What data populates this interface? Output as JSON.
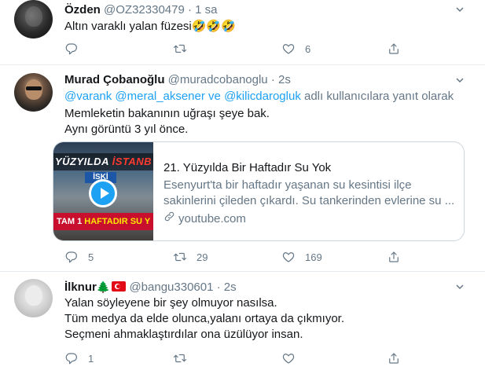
{
  "tweets": [
    {
      "name": "Özden",
      "handle": "@OZ32330479",
      "dot": "·",
      "time": "1 sa",
      "lines": [
        "Altın varaklı yalan füzesi🤣🤣🤣"
      ],
      "replies": "",
      "retweets": "",
      "likes": "6"
    },
    {
      "name": "Murad Çobanoğlu",
      "handle": "@muradcobanoglu",
      "dot": "·",
      "time": "2s",
      "reply_mentions": [
        "@varank",
        "@meral_aksener",
        "ve",
        "@kilicdarogluk"
      ],
      "reply_suffix": "adlı kullanıcılara yanıt olarak",
      "lines": [
        "Memleketin bakanının uğraşı şeye bak.",
        "Aynı görüntü 3 yıl önce."
      ],
      "card": {
        "thumb_top_white": "YÜZYILDA",
        "thumb_top_red": "İSTANB",
        "thumb_sign": "İSKİ",
        "thumb_bottom_white": "TAM 1",
        "thumb_bottom_yellow": "HAFTADIR SU Y",
        "title": "21. Yüzyılda Bir Haftadır Su Yok",
        "desc_line1": "Esenyurt'ta bir haftadır yaşanan su kesintisi ilçe",
        "desc_line2": "sakinlerini çileden çıkardı. Su tankerinden evlerine su ...",
        "link": "youtube.com"
      },
      "replies": "5",
      "retweets": "29",
      "likes": "169"
    },
    {
      "name": "İlknur",
      "handle": "@bangu330601",
      "dot": "·",
      "time": "2s",
      "name_emoji": "🌲",
      "lines": [
        "Yalan söyleyene bir şey olmuyor nasılsa.",
        "Tüm medya da elde olunca,yalanı ortaya da çıkmıyor.",
        "Seçmeni ahmaklaştırdılar ona üzülüyor insan."
      ],
      "replies": "1",
      "retweets": "",
      "likes": ""
    }
  ],
  "colors": {
    "accent": "#1da1f2",
    "muted": "#657786",
    "text": "#14171a",
    "border": "#e6ecf0"
  },
  "icons": [
    "reply-icon",
    "retweet-icon",
    "like-icon",
    "share-icon",
    "caret-down-icon",
    "link-icon",
    "play-icon"
  ]
}
